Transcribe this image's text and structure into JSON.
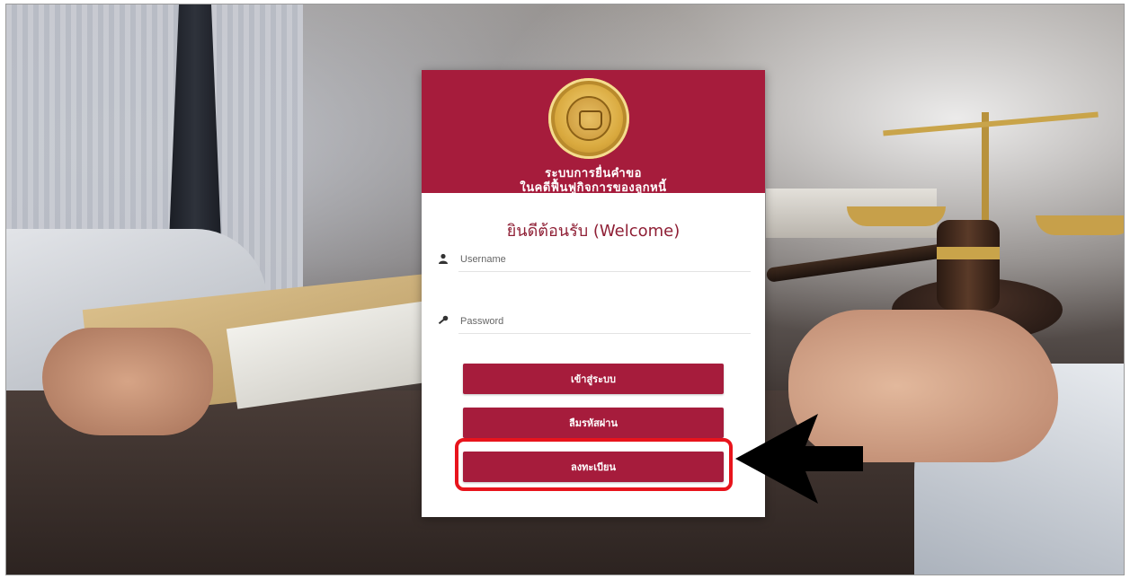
{
  "login": {
    "header_line1": "ระบบการยื่นคำขอ",
    "header_line2": "ในคดีฟื้นฟูกิจการของลูกหนี้",
    "welcome": "ยินดีต้อนรับ (Welcome)",
    "username_placeholder": "Username",
    "password_placeholder": "Password",
    "login_button": "เข้าสู่ระบบ",
    "forgot_password_button": "ลืมรหัสผ่าน",
    "register_button": "ลงทะเบียน"
  },
  "colors": {
    "brand": "#a61c3c",
    "highlight": "#e8141c",
    "arrow": "#000000"
  },
  "icons": [
    "seal-emblem",
    "user-icon",
    "key-icon",
    "arrow-left-icon"
  ]
}
